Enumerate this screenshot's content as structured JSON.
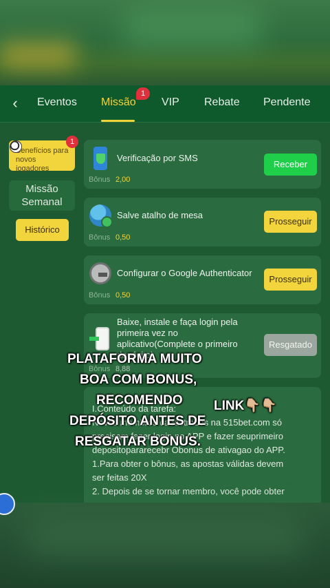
{
  "nav": {
    "tabs": [
      {
        "label": "Eventos"
      },
      {
        "label": "Missão",
        "badge": "1"
      },
      {
        "label": "VIP"
      },
      {
        "label": "Rebate"
      },
      {
        "label": "Pendente"
      }
    ],
    "back_icon": "chevron-left-icon"
  },
  "sidebar": {
    "benefit_label": "Benefícios para novos jogadores",
    "benefit_badge": "1",
    "weekly_label": "Missão Semanal",
    "history_label": "Histórico"
  },
  "tasks": [
    {
      "title": "Verificação por SMS",
      "bonus_label": "Bônus",
      "bonus_value": "2,00",
      "button": "Receber",
      "icon": "sms-shield-icon"
    },
    {
      "title": "Salve atalho de mesa",
      "bonus_label": "Bônus",
      "bonus_value": "0,50",
      "button": "Prosseguir",
      "icon": "globe-icon"
    },
    {
      "title": "Configurar o Google Authenticator",
      "bonus_label": "Bônus",
      "bonus_value": "0,50",
      "button": "Prosseguir",
      "icon": "authenticator-icon"
    },
    {
      "title": "Baixe, instale e faça login pela primeira vez no aplicativo(Complete o primeiro depósito)",
      "bonus_label": "Bônus",
      "bonus_value": "8,88",
      "button": "Resgatado",
      "icon": "download-phone-icon"
    }
  ],
  "description": {
    "line1": "I.Conteúdo da tarefa:",
    "line2": "Novos membros cadastrados na 515bet.com só",
    "line3": "precisam fazer login no APP e fazer seuprimeiro",
    "line4": "depositopararecebr Obonus de ativagao do APP.",
    "line5": "1.Para obter o bônus, as apostas válidas devem",
    "line6": "ser feitas 20X",
    "line7": "2. Depois de se tornar membro, você pode obter"
  },
  "overlay": {
    "line1": "PLATAFORMA MUITO",
    "line2": "BOA COM BONUS,",
    "line3": "RECOMENDO",
    "link": "LINK👇🏼👇🏼",
    "line4": "DEPÓSITO ANTES DE",
    "line5": "RESGATAR BONUS."
  },
  "colors": {
    "accent_yellow": "#f2d53c",
    "accent_green": "#1fcf4a",
    "badge_red": "#e0303b",
    "nav_bg": "#0f5a2c"
  }
}
